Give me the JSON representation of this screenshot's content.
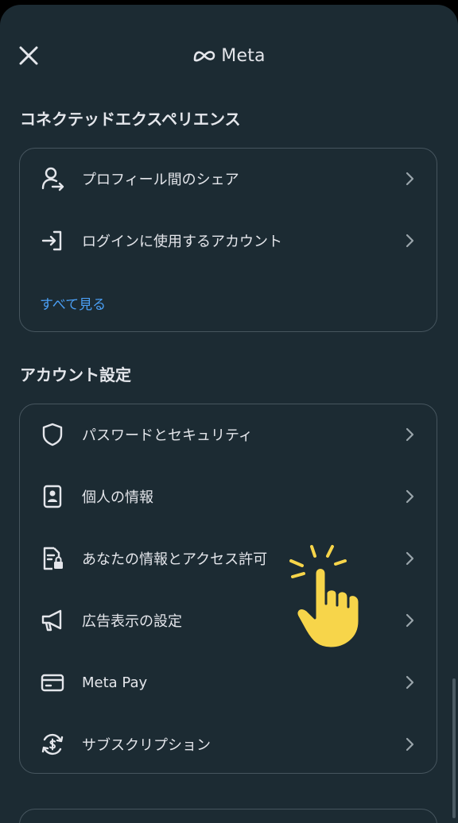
{
  "header": {
    "brand": "Meta"
  },
  "connected": {
    "title": "コネクテッドエクスペリエンス",
    "items": [
      {
        "label": "プロフィール間のシェア",
        "icon": "profile-share-icon"
      },
      {
        "label": "ログインに使用するアカウント",
        "icon": "login-arrow-icon"
      }
    ],
    "see_all": "すべて見る"
  },
  "account": {
    "title": "アカウント設定",
    "items": [
      {
        "label": "パスワードとセキュリティ",
        "icon": "shield-icon"
      },
      {
        "label": "個人の情報",
        "icon": "id-card-icon"
      },
      {
        "label": "あなたの情報とアクセス許可",
        "icon": "info-lock-icon"
      },
      {
        "label": "広告表示の設定",
        "icon": "megaphone-icon"
      },
      {
        "label": "Meta Pay",
        "icon": "credit-card-icon"
      },
      {
        "label": "サブスクリプション",
        "icon": "subscription-icon"
      }
    ]
  },
  "colors": {
    "background": "#1c2b33",
    "text": "#e4e6eb",
    "link": "#4a9ff5",
    "border": "#46555e",
    "pointer_highlight": "#f7d54a"
  }
}
